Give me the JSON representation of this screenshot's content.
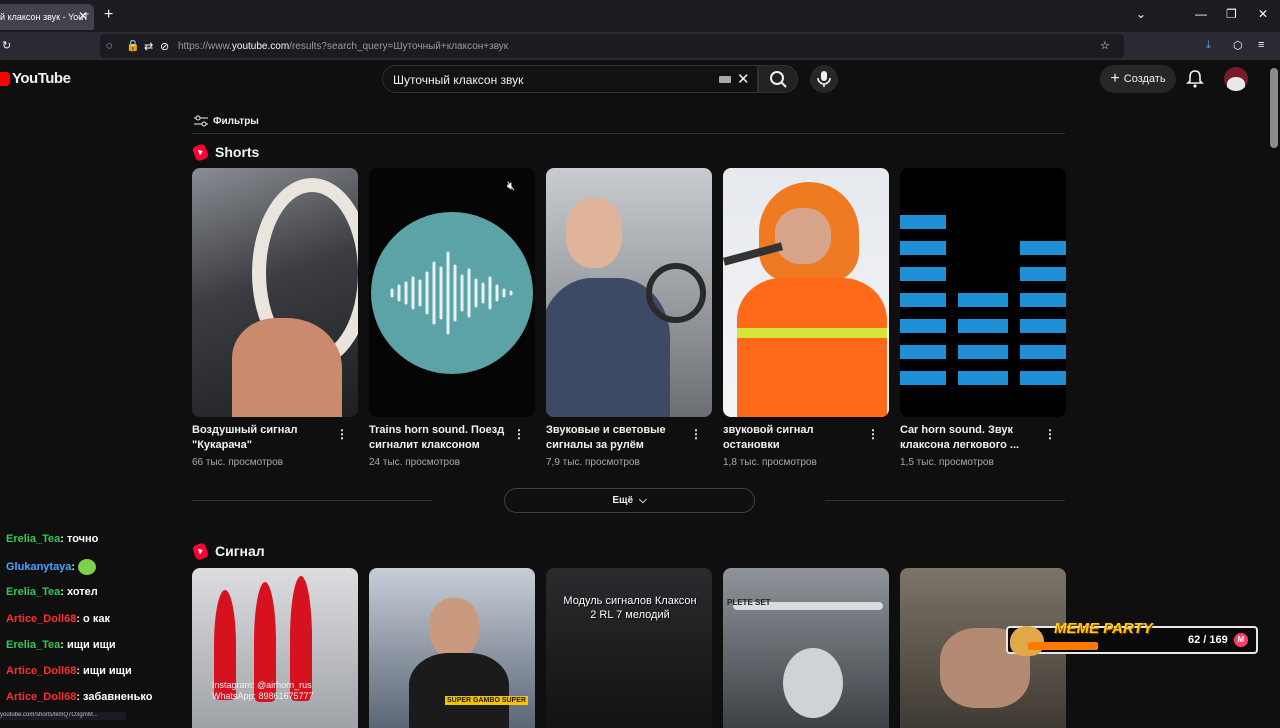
{
  "browser": {
    "tab_title": "й клаксон звук - YouT",
    "tab_close": "✕",
    "new_tab": "+",
    "url_prefix": "https://www.",
    "url_host": "youtube.com",
    "url_path": "/results?search_query=Шуточный+клаксон+звук",
    "status_url": "youtube.com/shorts/lkmQ7O3gmM..."
  },
  "header": {
    "logo_text": "YouTube",
    "search_value": "Шуточный клаксон звук",
    "create_label": "Создать",
    "accent": "#ff0000"
  },
  "filters_label": "Фильтры",
  "shorts": {
    "title": "Shorts",
    "items": [
      {
        "title": "Воздушный сигнал \"Кукарача\"",
        "views": "66 тыс. просмотров"
      },
      {
        "title": "Trains horn sound. Поезд сигналит клаксоном",
        "views": "24 тыс. просмотров"
      },
      {
        "title": "Звуковые и световые сигналы за рулём",
        "views": "7,9 тыс. просмотров"
      },
      {
        "title": "звуковой сигнал остановки",
        "views": "1,8 тыс. просмотров"
      },
      {
        "title": "Car horn sound. Звук клаксона легкового ...",
        "views": "1,5 тыс. просмотров"
      }
    ],
    "more_label": "Ещё"
  },
  "signal": {
    "title": "Сигнал",
    "items": [
      {
        "overlay": "Instagram: @airhorn_rus WhatsApp: 89861675777"
      },
      {
        "overlay": "SUPER GAMBO SUPER"
      },
      {
        "overlay": "Модуль сигналов Клаксон 2 RL 7 мелодий"
      },
      {
        "overlay": "PLETE SET"
      },
      {
        "overlay": ""
      }
    ]
  },
  "chat": [
    {
      "user": "Erelia_Tea",
      "color": "#34c759",
      "msg": "точно"
    },
    {
      "user": "Glukanytaya",
      "color": "#4aa3ff",
      "msg": ""
    },
    {
      "user": "Erelia_Tea",
      "color": "#34c759",
      "msg": "хотел"
    },
    {
      "user": "Artice_Doll68",
      "color": "#ff2d2d",
      "msg": "о как"
    },
    {
      "user": "Erelia_Tea",
      "color": "#34c759",
      "msg": "ищи ищи"
    },
    {
      "user": "Artice_Doll68",
      "color": "#ff2d2d",
      "msg": "ищи ищи"
    },
    {
      "user": "Artice_Doll68",
      "color": "#ff2d2d",
      "msg": "забавненько"
    }
  ],
  "overlay_widget": {
    "name": "MEME PARTY",
    "count": "62 / 169",
    "progress": 0.37
  }
}
